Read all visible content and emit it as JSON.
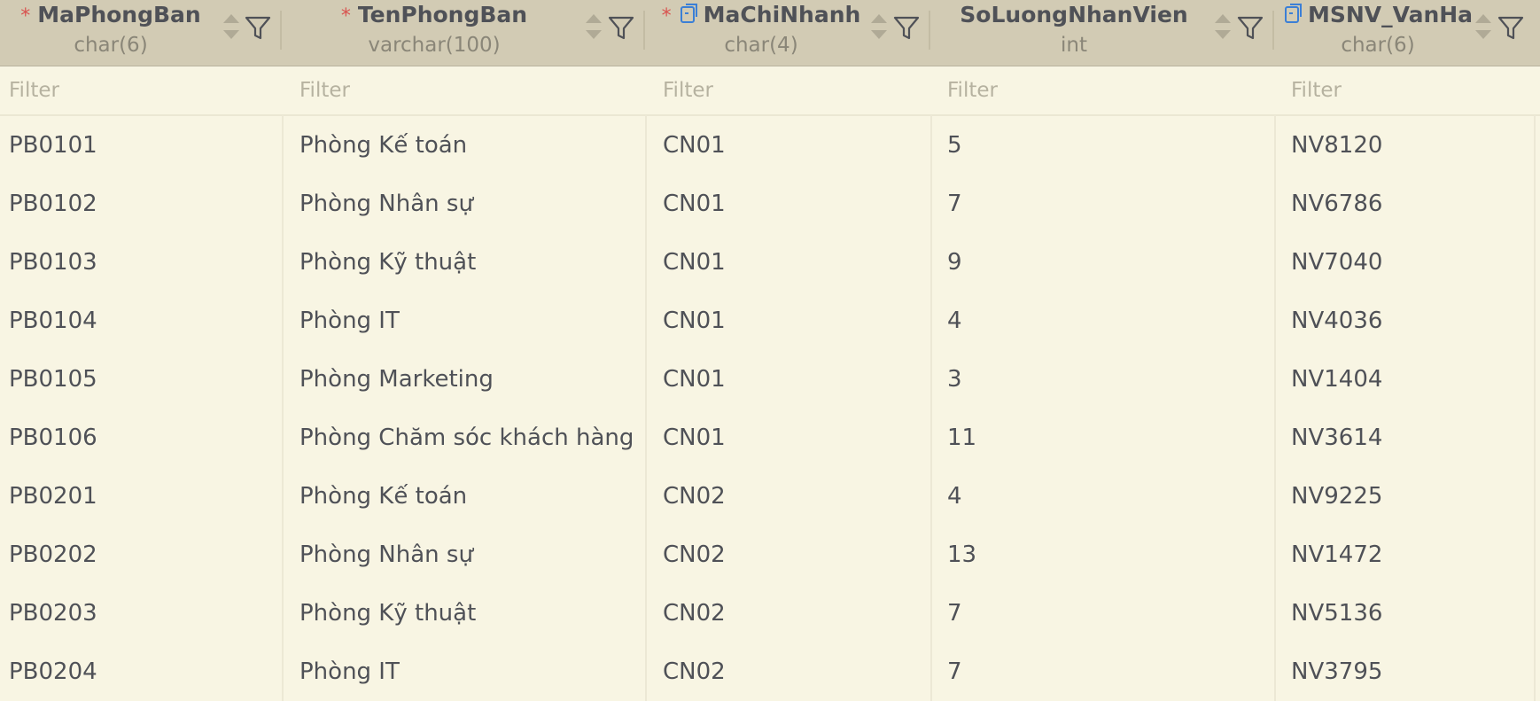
{
  "columns": [
    {
      "name": "MaPhongBan",
      "type": "char(6)",
      "required": true,
      "foreign_key": false
    },
    {
      "name": "TenPhongBan",
      "type": "varchar(100)",
      "required": true,
      "foreign_key": false
    },
    {
      "name": "MaChiNhanh",
      "type": "char(4)",
      "required": true,
      "foreign_key": true
    },
    {
      "name": "SoLuongNhanVien",
      "type": "int",
      "required": false,
      "foreign_key": false
    },
    {
      "name": "MSNV_VanHa",
      "type": "char(6)",
      "required": false,
      "foreign_key": true
    }
  ],
  "filter_placeholder": "Filter",
  "required_marker": "*",
  "icons": {
    "sort": "sort-updown-icon",
    "filter": "funnel-filter-icon",
    "fk": "foreign-key-icon"
  },
  "colors": {
    "header_bg": "#d2cbb4",
    "body_bg": "#f8f5e3",
    "required": "#d9534f",
    "fk": "#3b7fd6"
  },
  "rows": [
    [
      "PB0101",
      "Phòng Kế toán",
      "CN01",
      "5",
      "NV8120"
    ],
    [
      "PB0102",
      "Phòng Nhân sự",
      "CN01",
      "7",
      "NV6786"
    ],
    [
      "PB0103",
      "Phòng Kỹ thuật",
      "CN01",
      "9",
      "NV7040"
    ],
    [
      "PB0104",
      "Phòng IT",
      "CN01",
      "4",
      "NV4036"
    ],
    [
      "PB0105",
      "Phòng Marketing",
      "CN01",
      "3",
      "NV1404"
    ],
    [
      "PB0106",
      "Phòng Chăm sóc khách hàng",
      "CN01",
      "11",
      "NV3614"
    ],
    [
      "PB0201",
      "Phòng Kế toán",
      "CN02",
      "4",
      "NV9225"
    ],
    [
      "PB0202",
      "Phòng Nhân sự",
      "CN02",
      "13",
      "NV1472"
    ],
    [
      "PB0203",
      "Phòng Kỹ thuật",
      "CN02",
      "7",
      "NV5136"
    ],
    [
      "PB0204",
      "Phòng IT",
      "CN02",
      "7",
      "NV3795"
    ]
  ]
}
